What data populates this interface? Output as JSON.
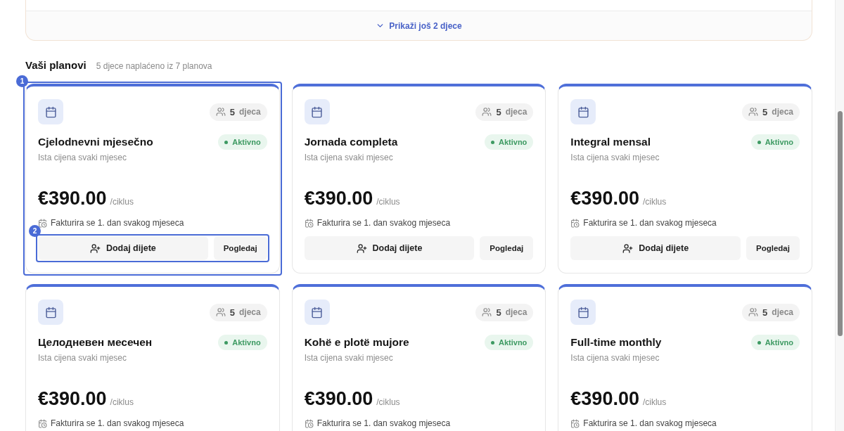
{
  "more_link": {
    "label": "Prikaži još 2 djece"
  },
  "section": {
    "title": "Vaši planovi",
    "subtitle": "5 djece naplaćeno iz 7 planova"
  },
  "plans": [
    {
      "name": "Cjelodnevni mjesečno",
      "description": "Ista cijena svaki mjesec",
      "children_count": "5",
      "children_label": "djeca",
      "active": true,
      "status_label": "Aktivno",
      "price": "€390.00",
      "period": "/ciklus",
      "billing": "Fakturira se 1. dan svakog mjeseca",
      "primary_action": "Dodaj dijete",
      "secondary_action": "Pogledaj",
      "card_marker": "1",
      "actions_marker": "2"
    },
    {
      "name": "Jornada completa",
      "description": "Ista cijena svaki mjesec",
      "children_count": "5",
      "children_label": "djeca",
      "active": true,
      "status_label": "Aktivno",
      "price": "€390.00",
      "period": "/ciklus",
      "billing": "Fakturira se 1. dan svakog mjeseca",
      "primary_action": "Dodaj dijete",
      "secondary_action": "Pogledaj"
    },
    {
      "name": "Integral mensal",
      "description": "Ista cijena svaki mjesec",
      "children_count": "5",
      "children_label": "djeca",
      "active": true,
      "status_label": "Aktivno",
      "price": "€390.00",
      "period": "/ciklus",
      "billing": "Fakturira se 1. dan svakog mjeseca",
      "primary_action": "Dodaj dijete",
      "secondary_action": "Pogledaj"
    },
    {
      "name": "Целодневен месечен",
      "description": "Ista cijena svaki mjesec",
      "children_count": "5",
      "children_label": "djeca",
      "active": true,
      "status_label": "Aktivno",
      "price": "€390.00",
      "period": "/ciklus",
      "billing": "Fakturira se 1. dan svakog mjeseca"
    },
    {
      "name": "Kohë e plotë mujore",
      "description": "Ista cijena svaki mjesec",
      "children_count": "5",
      "children_label": "djeca",
      "active": true,
      "status_label": "Aktivno",
      "price": "€390.00",
      "period": "/ciklus",
      "billing": "Fakturira se 1. dan svakog mjeseca"
    },
    {
      "name": "Full-time monthly",
      "description": "Ista cijena svaki mjesec",
      "children_count": "5",
      "children_label": "djeca",
      "active": true,
      "status_label": "Aktivno",
      "price": "€390.00",
      "period": "/ciklus",
      "billing": "Fakturira se 1. dan svakog mjeseca"
    }
  ]
}
